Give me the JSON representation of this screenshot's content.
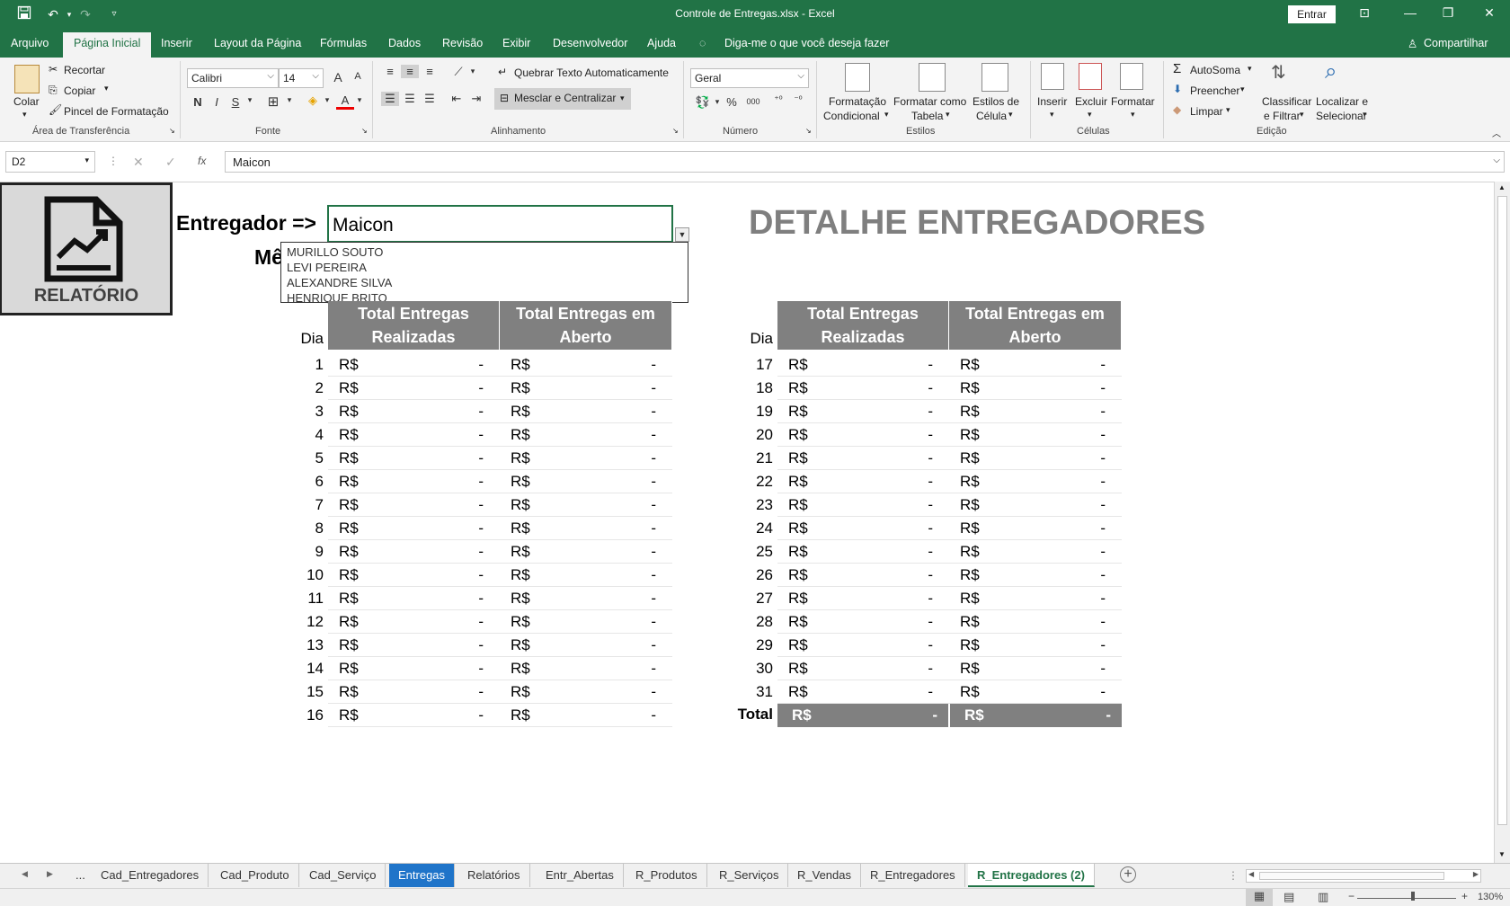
{
  "titlebar": {
    "title": "Controle de Entregas.xlsx  -  Excel",
    "enter_label": "Entrar"
  },
  "menu": {
    "items": [
      "Arquivo",
      "Página Inicial",
      "Inserir",
      "Layout da Página",
      "Fórmulas",
      "Dados",
      "Revisão",
      "Exibir",
      "Desenvolvedor",
      "Ajuda"
    ],
    "tell_me": "Diga-me o que você deseja fazer",
    "share": "Compartilhar"
  },
  "ribbon": {
    "clipboard": {
      "paste": "Colar",
      "cut": "Recortar",
      "copy": "Copiar",
      "format_painter": "Pincel de Formatação",
      "group": "Área de Transferência"
    },
    "font": {
      "name": "Calibri",
      "size": "14",
      "bold": "N",
      "italic": "I",
      "underline": "S",
      "grow": "A",
      "shrink": "A",
      "color": "A",
      "group": "Fonte"
    },
    "alignment": {
      "wrap": "Quebrar Texto Automaticamente",
      "merge": "Mesclar e Centralizar",
      "group": "Alinhamento"
    },
    "number": {
      "format": "Geral",
      "percent": "%",
      "thousands": "000",
      "group": "Número"
    },
    "styles": {
      "cond_line1": "Formatação",
      "cond_line2": "Condicional",
      "table_line1": "Formatar como",
      "table_line2": "Tabela",
      "cell_line1": "Estilos de",
      "cell_line2": "Célula",
      "group": "Estilos"
    },
    "cells": {
      "insert": "Inserir",
      "delete": "Excluir",
      "format": "Formatar",
      "group": "Células"
    },
    "editing": {
      "autosum": "AutoSoma",
      "fill": "Preencher",
      "clear": "Limpar",
      "sort_line1": "Classificar",
      "sort_line2": "e Filtrar",
      "find_line1": "Localizar e",
      "find_line2": "Selecionar",
      "group": "Edição"
    }
  },
  "formula_bar": {
    "cell_ref": "D2",
    "fx": "fx",
    "content": "Maicon"
  },
  "sheet": {
    "logo_label": "RELATÓRIO",
    "entregador_label": "Entregador =>",
    "me_label": "Mê",
    "selected_value": "Maicon",
    "dropdown_options": [
      "MURILLO SOUTO",
      "LEVI PEREIRA",
      "ALEXANDRE SILVA",
      "HENRIQUE BRITO"
    ],
    "title": "DETALHE ENTREGADORES",
    "dia_label": "Dia",
    "col1_line1": "Total Entregas",
    "col1_line2": "Realizadas",
    "col2_line1": "Total Entregas em",
    "col2_line2": "Aberto",
    "currency": "R$",
    "empty_value": "-",
    "total_label": "Total",
    "left_days": [
      "1",
      "2",
      "3",
      "4",
      "5",
      "6",
      "7",
      "8",
      "9",
      "10",
      "11",
      "12",
      "13",
      "14",
      "15",
      "16"
    ],
    "right_days": [
      "17",
      "18",
      "19",
      "20",
      "21",
      "22",
      "23",
      "24",
      "25",
      "26",
      "27",
      "28",
      "29",
      "30",
      "31"
    ]
  },
  "tabs": {
    "items": [
      "Cad_Entregadores",
      "Cad_Produto",
      "Cad_Serviço",
      "Entregas",
      "Relatórios",
      "Entr_Abertas",
      "R_Produtos",
      "R_Serviços",
      "R_Vendas",
      "R_Entregadores",
      "R_Entregadores (2)"
    ],
    "more": "...",
    "add": "+"
  },
  "status": {
    "zoom": "130%"
  },
  "colors": {
    "excel_green": "#217346",
    "header_gray": "#808080",
    "title_gray": "#7f7f7f"
  }
}
